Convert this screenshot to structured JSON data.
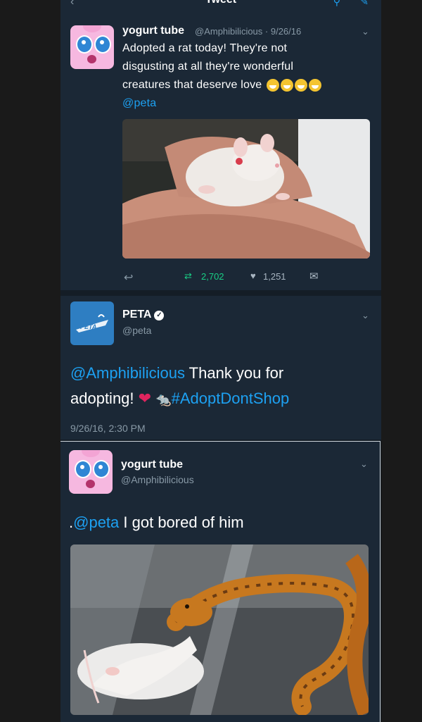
{
  "header": {
    "title": "Tweet"
  },
  "tweet1": {
    "name": "yogurt tube",
    "handle": "@Amphibilicious",
    "date": "· 9/26/16",
    "text_line1": "Adopted a rat today! They're not",
    "text_line2": "disgusting at all they're wonderful",
    "text_line3": "creatures that deserve love",
    "mention": "@peta",
    "retweets": "2,702",
    "likes": "1,251"
  },
  "tweet2": {
    "name": "PETA",
    "handle": "@peta",
    "mention": "@Amphibilicious",
    "text_a": " Thank you for",
    "text_b": "adopting!",
    "hashtag": "#AdoptDontShop",
    "timestamp": "9/26/16, 2:30 PM",
    "logo_text": "PETA"
  },
  "tweet3": {
    "name": "yogurt tube",
    "handle": "@Amphibilicious",
    "prefix": ".",
    "mention": "@peta",
    "text": " I got bored of him"
  },
  "colors": {
    "tweet_bg": "#1b2836",
    "page_bg": "#141d26",
    "link": "#1da1f2",
    "retweet": "#19cf86",
    "heart": "#e0245e"
  },
  "icons": [
    "back-arrow-icon",
    "search-icon",
    "compose-icon",
    "chevron-down-icon",
    "reply-icon",
    "retweet-icon",
    "like-icon",
    "message-icon",
    "verified-icon",
    "heart-emoji-icon",
    "rat-emoji-icon",
    "grin-emoji-icon"
  ]
}
